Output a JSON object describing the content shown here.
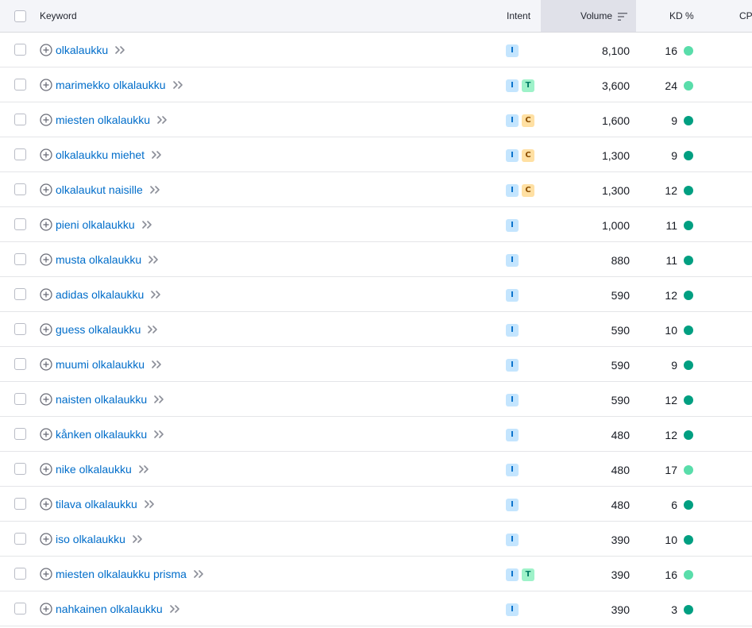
{
  "header": {
    "keyword": "Keyword",
    "intent": "Intent",
    "volume": "Volume",
    "kd": "KD %",
    "cpc": "CP"
  },
  "colors": {
    "link": "#006dca",
    "kd_light": "#59ddaa",
    "kd_dark": "#009f81",
    "intent_I_bg": "#c4e5fe",
    "intent_T_bg": "#9ef2c9",
    "intent_C_bg": "#ffe0a3"
  },
  "rows": [
    {
      "keyword": "olkalaukku",
      "intents": [
        "I"
      ],
      "volume": "8,100",
      "kd": "16",
      "kd_level": "light"
    },
    {
      "keyword": "marimekko olkalaukku",
      "intents": [
        "I",
        "T"
      ],
      "volume": "3,600",
      "kd": "24",
      "kd_level": "light"
    },
    {
      "keyword": "miesten olkalaukku",
      "intents": [
        "I",
        "C"
      ],
      "volume": "1,600",
      "kd": "9",
      "kd_level": "dark"
    },
    {
      "keyword": "olkalaukku miehet",
      "intents": [
        "I",
        "C"
      ],
      "volume": "1,300",
      "kd": "9",
      "kd_level": "dark"
    },
    {
      "keyword": "olkalaukut naisille",
      "intents": [
        "I",
        "C"
      ],
      "volume": "1,300",
      "kd": "12",
      "kd_level": "dark"
    },
    {
      "keyword": "pieni olkalaukku",
      "intents": [
        "I"
      ],
      "volume": "1,000",
      "kd": "11",
      "kd_level": "dark"
    },
    {
      "keyword": "musta olkalaukku",
      "intents": [
        "I"
      ],
      "volume": "880",
      "kd": "11",
      "kd_level": "dark"
    },
    {
      "keyword": "adidas olkalaukku",
      "intents": [
        "I"
      ],
      "volume": "590",
      "kd": "12",
      "kd_level": "dark"
    },
    {
      "keyword": "guess olkalaukku",
      "intents": [
        "I"
      ],
      "volume": "590",
      "kd": "10",
      "kd_level": "dark"
    },
    {
      "keyword": "muumi olkalaukku",
      "intents": [
        "I"
      ],
      "volume": "590",
      "kd": "9",
      "kd_level": "dark"
    },
    {
      "keyword": "naisten olkalaukku",
      "intents": [
        "I"
      ],
      "volume": "590",
      "kd": "12",
      "kd_level": "dark"
    },
    {
      "keyword": "kånken olkalaukku",
      "intents": [
        "I"
      ],
      "volume": "480",
      "kd": "12",
      "kd_level": "dark"
    },
    {
      "keyword": "nike olkalaukku",
      "intents": [
        "I"
      ],
      "volume": "480",
      "kd": "17",
      "kd_level": "light"
    },
    {
      "keyword": "tilava olkalaukku",
      "intents": [
        "I"
      ],
      "volume": "480",
      "kd": "6",
      "kd_level": "dark"
    },
    {
      "keyword": "iso olkalaukku",
      "intents": [
        "I"
      ],
      "volume": "390",
      "kd": "10",
      "kd_level": "dark"
    },
    {
      "keyword": "miesten olkalaukku prisma",
      "intents": [
        "I",
        "T"
      ],
      "volume": "390",
      "kd": "16",
      "kd_level": "light"
    },
    {
      "keyword": "nahkainen olkalaukku",
      "intents": [
        "I"
      ],
      "volume": "390",
      "kd": "3",
      "kd_level": "dark"
    }
  ]
}
